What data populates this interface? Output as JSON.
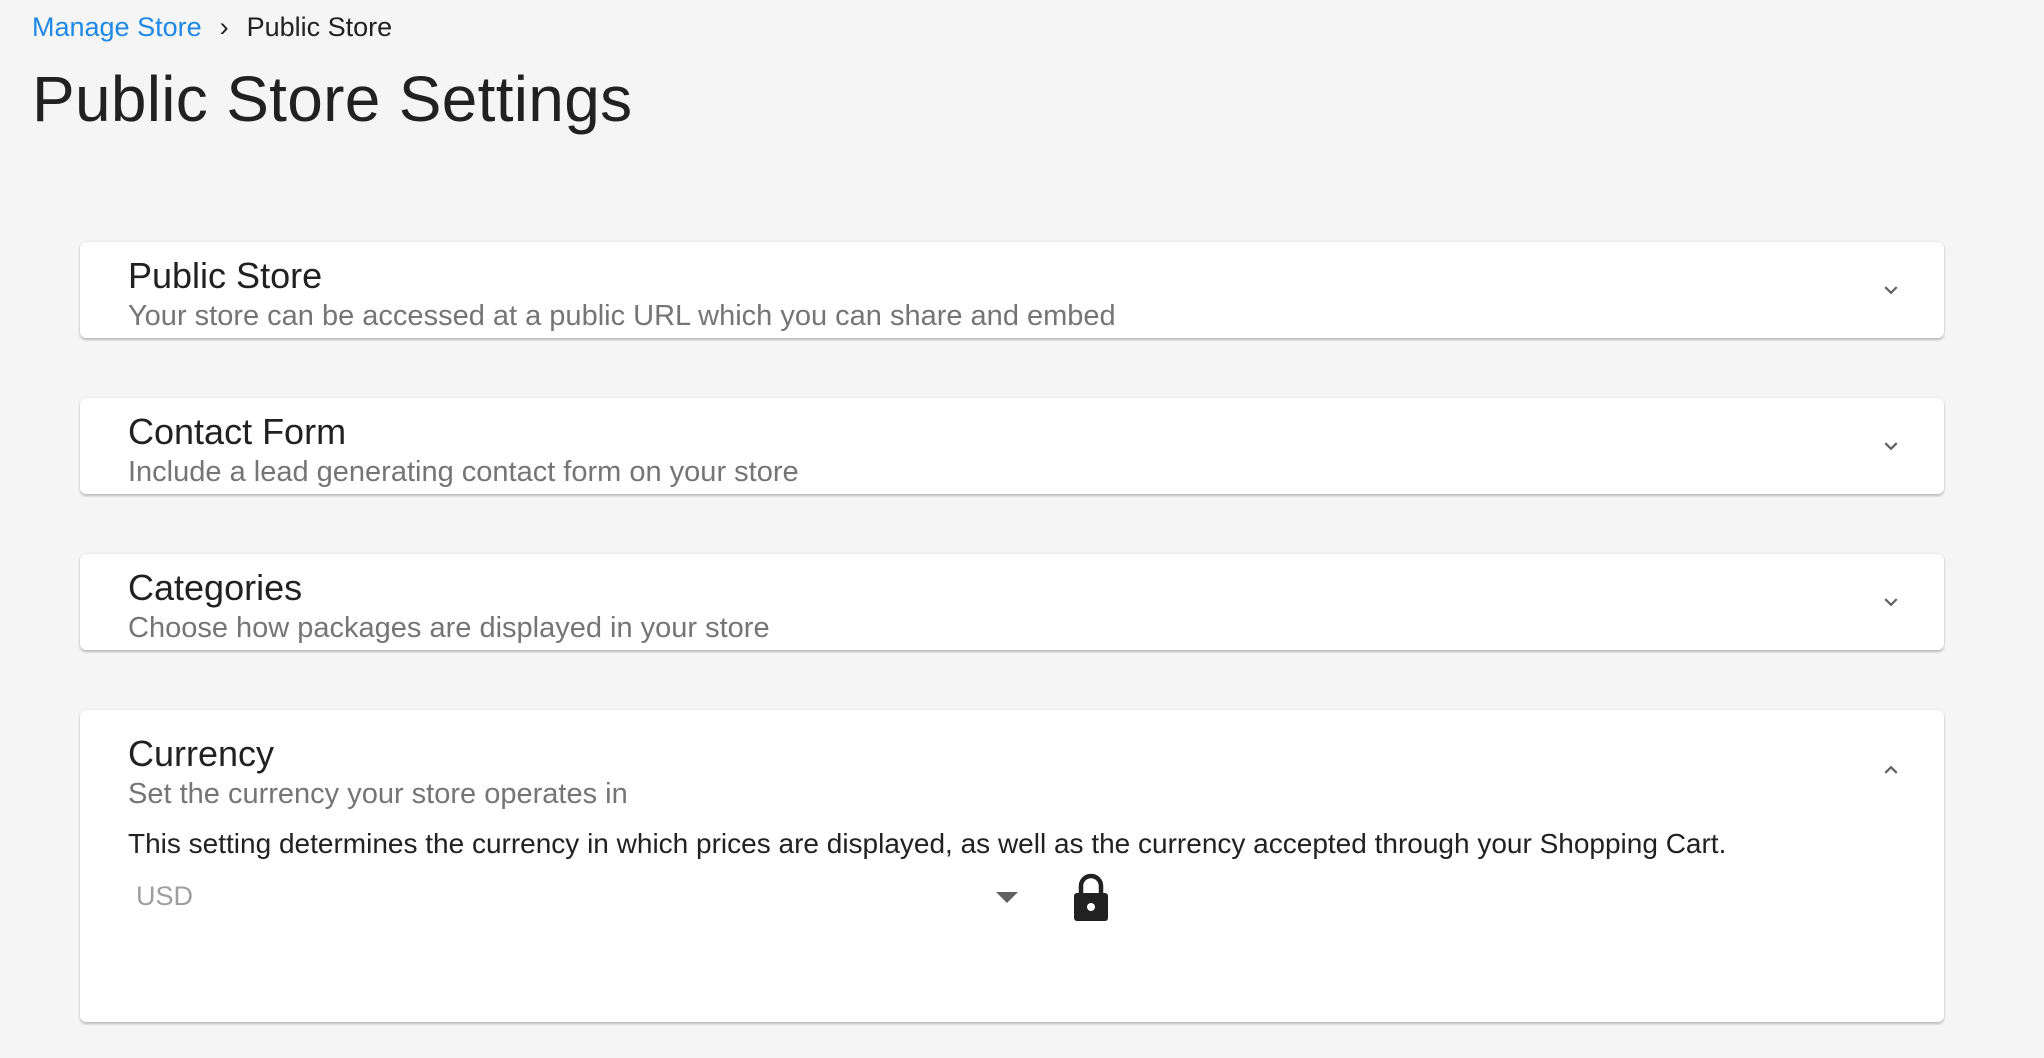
{
  "breadcrumb": {
    "link_label": "Manage Store",
    "separator": "›",
    "current_label": "Public Store"
  },
  "page": {
    "title": "Public Store Settings"
  },
  "panels": [
    {
      "title": "Public Store",
      "subtitle": "Your store can be accessed at a public URL which you can share and embed",
      "expanded": false,
      "icon": "chevron-down-icon"
    },
    {
      "title": "Contact Form",
      "subtitle": "Include a lead generating contact form on your store",
      "expanded": false,
      "icon": "chevron-down-icon"
    },
    {
      "title": "Categories",
      "subtitle": "Choose how packages are displayed in your store",
      "expanded": false,
      "icon": "chevron-down-icon"
    },
    {
      "title": "Currency",
      "subtitle": "Set the currency your store operates in",
      "expanded": true,
      "icon": "chevron-up-icon",
      "description": "This setting determines the currency in which prices are displayed, as well as the currency accepted through your Shopping Cart.",
      "select": {
        "value": "USD",
        "disabled": true,
        "icon": "caret-down-icon"
      },
      "lock_icon": "lock-icon"
    }
  ],
  "colors": {
    "background": "#f5f5f5",
    "link": "#1e88e5",
    "card": "#ffffff",
    "subtitle": "#757575",
    "disabled_text": "#9e9e9e",
    "icon": "#616161"
  }
}
